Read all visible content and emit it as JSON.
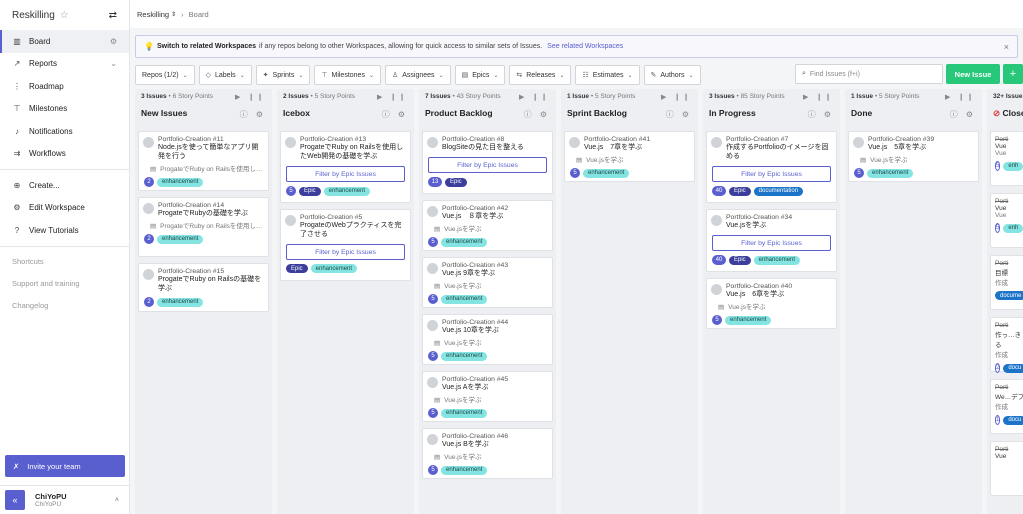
{
  "sidebar": {
    "workspace": "Reskilling",
    "nav": [
      {
        "label": "Board",
        "icon": "board-icon",
        "active": true,
        "right": "⚙"
      },
      {
        "label": "Reports",
        "icon": "reports-icon",
        "right": "⌄"
      },
      {
        "label": "Roadmap",
        "icon": "roadmap-icon"
      },
      {
        "label": "Milestones",
        "icon": "milestones-icon"
      },
      {
        "label": "Notifications",
        "icon": "bell-icon"
      },
      {
        "label": "Workflows",
        "icon": "workflows-icon"
      }
    ],
    "actions": [
      {
        "label": "Create...",
        "icon": "plus-circle-icon"
      },
      {
        "label": "Edit Workspace",
        "icon": "gear-icon"
      },
      {
        "label": "View Tutorials",
        "icon": "question-icon"
      }
    ],
    "muted": [
      "Shortcuts",
      "Support and training",
      "Changelog"
    ],
    "invite": "Invite your team",
    "user_name": "ChiYoPU",
    "user_sub": "ChiYoPU"
  },
  "breadcrumb": {
    "workspace": "Reskilling",
    "page": "Board"
  },
  "banner": {
    "strong": "Switch to related Workspaces",
    "text": "if any repos belong to other Workspaces, allowing for quick access to similar sets of Issues.",
    "link": "See related Workspaces"
  },
  "filters": [
    {
      "label": "Repos (1/2)",
      "icon": ""
    },
    {
      "label": "Labels",
      "icon": "◇"
    },
    {
      "label": "Sprints",
      "icon": "✦"
    },
    {
      "label": "Milestones",
      "icon": "⊤"
    },
    {
      "label": "Assignees",
      "icon": "♙"
    },
    {
      "label": "Epics",
      "icon": "▤"
    },
    {
      "label": "Releases",
      "icon": "⇆"
    },
    {
      "label": "Estimates",
      "icon": "☷"
    },
    {
      "label": "Authors",
      "icon": "✎"
    }
  ],
  "search": {
    "placeholder": "Find Issues (f+i)"
  },
  "new_issue": "New Issue",
  "columns": [
    {
      "name": "New Issues",
      "issues": "3 Issues",
      "points": "6 Story Points",
      "cards": [
        {
          "ref": "Portfolio-Creation #11",
          "title": "Node.jsを使って簡単なアプリ開発を行う",
          "epic": "ProgateでRuby on Railsを使用し…",
          "points": "2",
          "labels": [
            "enhancement"
          ]
        },
        {
          "ref": "Portfolio-Creation #14",
          "title": "ProgateでRubyの基礎を学ぶ",
          "epic": "ProgateでRuby on Railsを使用し…",
          "points": "2",
          "labels": [
            "enhancement"
          ]
        },
        {
          "ref": "Portfolio-Creation #15",
          "title": "ProgateでRuby on Railsの基礎を学ぶ",
          "epic": "",
          "points": "2",
          "labels": [
            "enhancement"
          ]
        }
      ]
    },
    {
      "name": "Icebox",
      "issues": "2 Issues",
      "points": "5 Story Points",
      "cards": [
        {
          "ref": "Portfolio-Creation #13",
          "title": "ProgateでRuby on Railsを使用したWeb開発の基礎を学ぶ",
          "filter": "Filter by Epic Issues",
          "points": "5",
          "labels": [
            "Epic",
            "enhancement"
          ]
        },
        {
          "ref": "Portfolio-Creation #5",
          "title": "ProgateのWebプラクティスを完了させる",
          "filter": "Filter by Epic Issues",
          "points": "",
          "labels": [
            "Epic",
            "enhancement"
          ]
        }
      ]
    },
    {
      "name": "Product Backlog",
      "issues": "7 Issues",
      "points": "43 Story Points",
      "cards": [
        {
          "ref": "Portfolio-Creation #8",
          "title": "BlogSiteの見た目を整える",
          "filter": "Filter by Epic Issues",
          "points": "13",
          "labels": [
            "Epic"
          ]
        },
        {
          "ref": "Portfolio-Creation #42",
          "title": "Vue.js　８章を学ぶ",
          "epic": "Vue.jsを学ぶ",
          "points": "5",
          "labels": [
            "enhancement"
          ]
        },
        {
          "ref": "Portfolio-Creation #43",
          "title": "Vue.js 9章を学ぶ",
          "epic": "Vue.jsを学ぶ",
          "points": "5",
          "labels": [
            "enhancement"
          ]
        },
        {
          "ref": "Portfolio-Creation #44",
          "title": "Vue.js 10章を学ぶ",
          "epic": "Vue.jsを学ぶ",
          "points": "5",
          "labels": [
            "enhancement"
          ]
        },
        {
          "ref": "Portfolio-Creation #45",
          "title": "Vue.js Aを学ぶ",
          "epic": "Vue.jsを学ぶ",
          "points": "5",
          "labels": [
            "enhancement"
          ]
        },
        {
          "ref": "Portfolio-Creation #46",
          "title": "Vue.js Bを学ぶ",
          "epic": "Vue.jsを学ぶ",
          "points": "5",
          "labels": [
            "enhancement"
          ]
        }
      ]
    },
    {
      "name": "Sprint Backlog",
      "issues": "1 Issue",
      "points": "5 Story Points",
      "cards": [
        {
          "ref": "Portfolio-Creation #41",
          "title": "Vue.js　7章を学ぶ",
          "epic": "Vue.jsを学ぶ",
          "points": "5",
          "labels": [
            "enhancement"
          ]
        }
      ]
    },
    {
      "name": "In Progress",
      "issues": "3 Issues",
      "points": "85 Story Points",
      "cards": [
        {
          "ref": "Portfolio-Creation #7",
          "title": "作成するPortfolioのイメージを固める",
          "filter": "Filter by Epic Issues",
          "points": "40",
          "labels": [
            "Epic",
            "documentation"
          ]
        },
        {
          "ref": "Portfolio-Creation #34",
          "title": "Vue.jsを学ぶ",
          "filter": "Filter by Epic Issues",
          "points": "40",
          "labels": [
            "Epic",
            "enhancement"
          ]
        },
        {
          "ref": "Portfolio-Creation #40",
          "title": "Vue.js　6章を学ぶ",
          "epic": "Vue.jsを学ぶ",
          "points": "5",
          "labels": [
            "enhancement"
          ]
        }
      ]
    },
    {
      "name": "Done",
      "issues": "1 Issue",
      "points": "5 Story Points",
      "cards": [
        {
          "ref": "Portfolio-Creation #39",
          "title": "Vue.js　5章を学ぶ",
          "epic": "Vue.jsを学ぶ",
          "points": "5",
          "labels": [
            "enhancement"
          ]
        }
      ]
    },
    {
      "name": "Close",
      "issues": "32+ Issue",
      "closed": [
        {
          "line": "Porti",
          "title": "Vue",
          "epic": "Vue",
          "points": "5",
          "label": "enh"
        },
        {
          "line": "Porti",
          "title": "Vue",
          "epic": "Vue",
          "points": "5",
          "label": "enh"
        },
        {
          "line": "Porti",
          "title": "目標",
          "epic": "作成",
          "points": "",
          "label": "docume"
        },
        {
          "line": "Porti",
          "title": "作っ…きる",
          "epic": "作成",
          "points": "2",
          "label": "docu"
        },
        {
          "line": "Porti",
          "title": "We…デフ",
          "epic": "作成",
          "points": "1",
          "label": "docu"
        },
        {
          "line": "Porti",
          "title": "Vue",
          "epic": "",
          "points": "",
          "label": ""
        }
      ]
    }
  ]
}
